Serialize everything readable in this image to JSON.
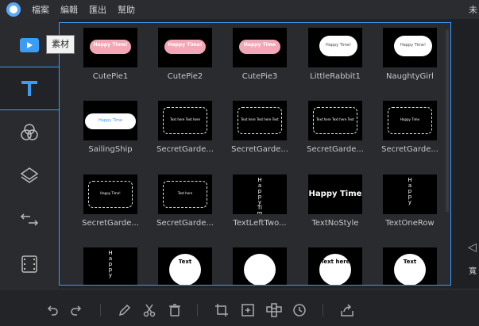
{
  "menubar": {
    "items": [
      "檔案",
      "編輯",
      "匯出",
      "幫助"
    ],
    "right_text": "未"
  },
  "rail": {
    "tooltip": "素材",
    "items": [
      {
        "name": "media",
        "icon": "media-folder-icon"
      },
      {
        "name": "text",
        "icon": "text-t-icon",
        "active": true
      },
      {
        "name": "filters",
        "icon": "filters-icon"
      },
      {
        "name": "overlays",
        "icon": "overlays-layers-icon"
      },
      {
        "name": "transitions",
        "icon": "transition-arrows-icon"
      },
      {
        "name": "elements",
        "icon": "film-strip-icon"
      }
    ]
  },
  "tiles": [
    {
      "label": "CutePie1",
      "thumb_text": "Happy Time!"
    },
    {
      "label": "CutePie2",
      "thumb_text": "Happy Time!"
    },
    {
      "label": "CutePie3",
      "thumb_text": "Happy Time"
    },
    {
      "label": "LittleRabbit1",
      "thumb_text": "Happy Time!"
    },
    {
      "label": "NaughtyGirl",
      "thumb_text": "Happy Time!"
    },
    {
      "label": "SailingShip",
      "thumb_text": "Happy Time"
    },
    {
      "label": "SecretGarde...",
      "thumb_text": "Text here Text here"
    },
    {
      "label": "SecretGarde...",
      "thumb_text": "Text here Text here Text"
    },
    {
      "label": "SecretGarde...",
      "thumb_text": "Text here Text here Text"
    },
    {
      "label": "SecretGarde...",
      "thumb_text": "Happy Time"
    },
    {
      "label": "SecretGarde...",
      "thumb_text": "Happy Time!"
    },
    {
      "label": "SecretGarde...",
      "thumb_text": "Text here"
    },
    {
      "label": "TextLeftTwo...",
      "thumb_text": "Happy Time"
    },
    {
      "label": "TextNoStyle",
      "thumb_text": "Happy Time"
    },
    {
      "label": "TextOneRow",
      "thumb_text": "Happy"
    },
    {
      "label": "",
      "thumb_text": "Happy"
    },
    {
      "label": "",
      "thumb_text": "Text"
    },
    {
      "label": "",
      "thumb_text": ""
    },
    {
      "label": "",
      "thumb_text": "Text here"
    },
    {
      "label": "",
      "thumb_text": "Text"
    }
  ],
  "right": {
    "label": "寬"
  },
  "toolbar": {
    "buttons": [
      "undo-icon",
      "redo-icon",
      "edit-pencil-icon",
      "cut-scissors-icon",
      "delete-trash-icon",
      "crop-icon",
      "zoom-fit-icon",
      "mosaic-icon",
      "duration-clock-icon",
      "share-export-icon"
    ]
  },
  "colors": {
    "accent": "#3b9cf5",
    "bg": "#232427",
    "panel": "#2a2b2f"
  }
}
